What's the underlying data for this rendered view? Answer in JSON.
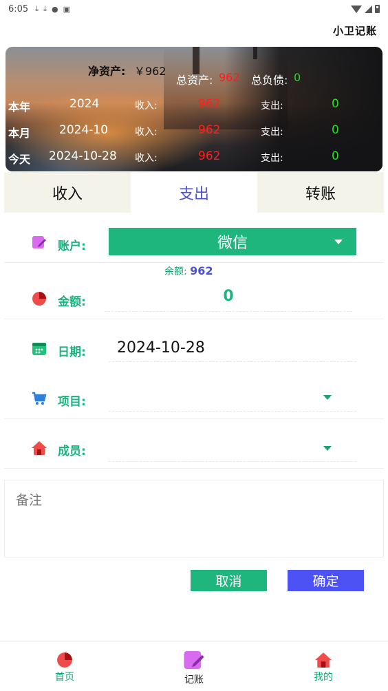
{
  "status_bar": {
    "time": "6:05"
  },
  "app_title": "小卫记账",
  "summary": {
    "net_assets_label": "净资产:",
    "net_assets_value": "￥962",
    "total_assets_label": "总资产:",
    "total_assets_value": "962",
    "total_debt_label": "总负债:",
    "total_debt_value": "0",
    "rows": [
      {
        "label": "本年",
        "period": "2024",
        "income_label": "收入:",
        "income": "962",
        "expense_label": "支出:",
        "expense": "0"
      },
      {
        "label": "本月",
        "period": "2024-10",
        "income_label": "收入:",
        "income": "962",
        "expense_label": "支出:",
        "expense": "0"
      },
      {
        "label": "今天",
        "period": "2024-10-28",
        "income_label": "收入:",
        "income": "962",
        "expense_label": "支出:",
        "expense": "0"
      }
    ]
  },
  "tabs": [
    {
      "label": "收入",
      "active": false
    },
    {
      "label": "支出",
      "active": true
    },
    {
      "label": "转账",
      "active": false
    }
  ],
  "form": {
    "account_label": "账户:",
    "account_value": "微信",
    "balance_label": "余额:",
    "balance_value": "962",
    "amount_label": "金额:",
    "amount_value": "0",
    "date_label": "日期:",
    "date_value": "2024-10-28",
    "item_label": "项目:",
    "item_value": "",
    "member_label": "成员:",
    "member_value": "",
    "remark_placeholder": "备注"
  },
  "buttons": {
    "cancel": "取消",
    "confirm": "确定"
  },
  "bottom_nav": [
    {
      "label": "首页",
      "icon": "pie-chart-icon"
    },
    {
      "label": "记账",
      "icon": "edit-note-icon"
    },
    {
      "label": "我的",
      "icon": "home-icon"
    }
  ],
  "colors": {
    "accent_green": "#1fb67d",
    "accent_blue": "#4d52f5",
    "income_red": "#ff2020",
    "expense_green": "#22dd22"
  }
}
